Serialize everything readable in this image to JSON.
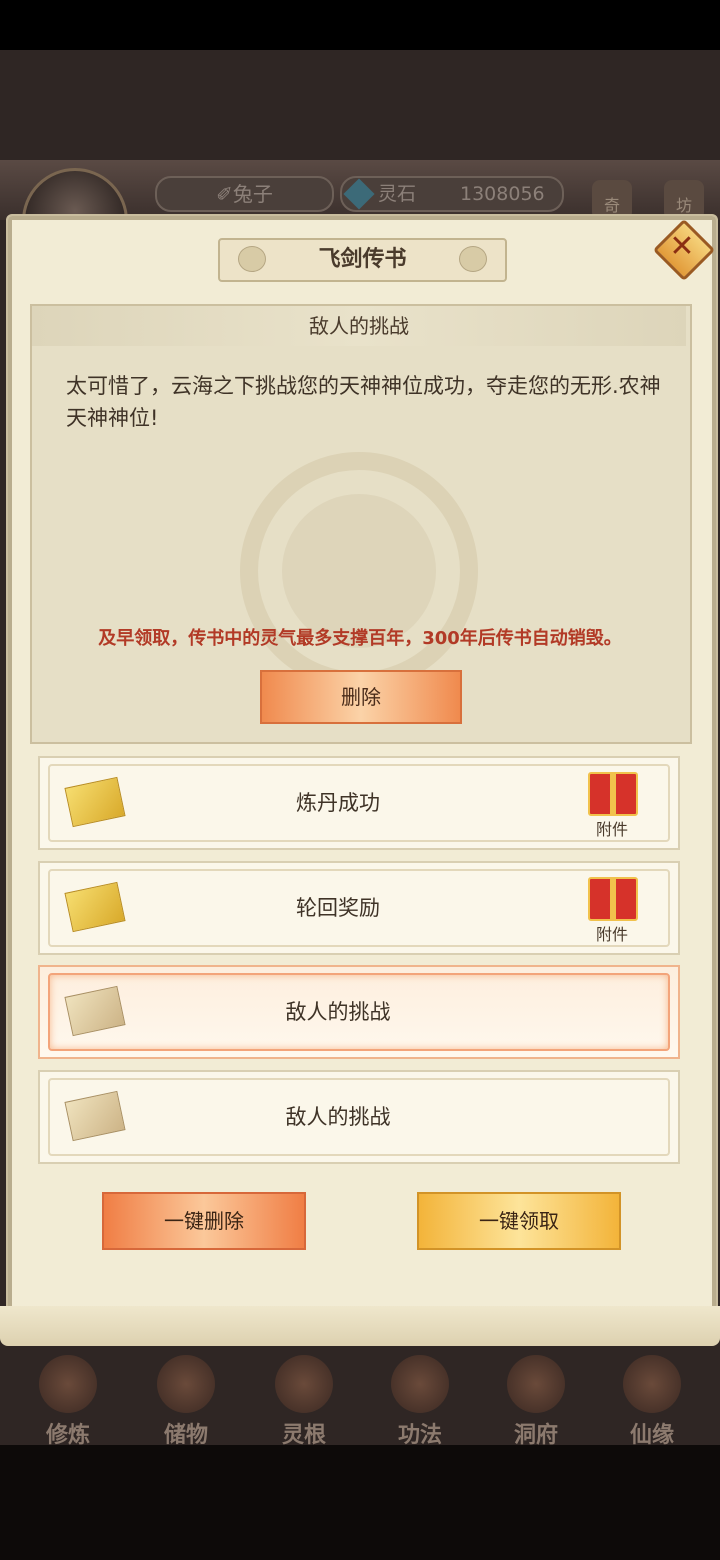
{
  "hud": {
    "player_name": "✐兔子",
    "currency_label": "灵石",
    "currency_value": "1308056",
    "side_btn_1": "奇",
    "side_btn_2": "坊"
  },
  "bottom_nav": [
    {
      "label": "修炼",
      "icon": "cultivate-icon"
    },
    {
      "label": "储物",
      "icon": "storage-bag-icon"
    },
    {
      "label": "灵根",
      "icon": "spirit-root-icon"
    },
    {
      "label": "功法",
      "icon": "technique-book-icon"
    },
    {
      "label": "洞府",
      "icon": "cave-house-icon"
    },
    {
      "label": "仙缘",
      "icon": "immortal-fate-icon"
    }
  ],
  "dialog": {
    "title": "飞剑传书",
    "close_icon": "close-icon"
  },
  "message": {
    "title": "敌人的挑战",
    "body": "太可惜了，云海之下挑战您的天神神位成功，夺走您的无形.农神天神神位!",
    "warning": "及早领取，传书中的灵气最多支撑百年，300年后传书自动销毁。",
    "delete_label": "删除"
  },
  "mail_list": [
    {
      "subject": "炼丹成功",
      "read": false,
      "attachment": true,
      "attachment_label": "附件",
      "selected": false
    },
    {
      "subject": "轮回奖励",
      "read": false,
      "attachment": true,
      "attachment_label": "附件",
      "selected": false
    },
    {
      "subject": "敌人的挑战",
      "read": true,
      "attachment": false,
      "selected": true
    },
    {
      "subject": "敌人的挑战",
      "read": true,
      "attachment": false,
      "selected": false
    }
  ],
  "footer": {
    "delete_all_label": "一键删除",
    "claim_all_label": "一键领取"
  }
}
